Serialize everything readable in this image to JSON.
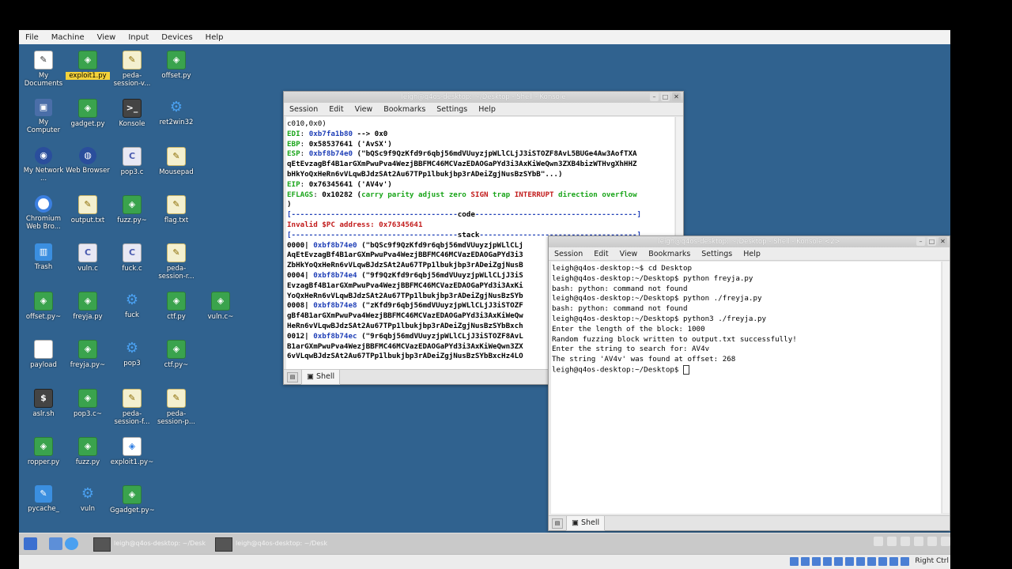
{
  "vm_menu": [
    "File",
    "Machine",
    "View",
    "Input",
    "Devices",
    "Help"
  ],
  "desktop_icons": [
    {
      "label": "My Documents",
      "icon": "my-documents-icon",
      "cls": "g-doc",
      "glyph": "✎",
      "col": 0,
      "row": 0
    },
    {
      "label": "exploit1.py",
      "icon": "python-file-icon",
      "cls": "g-py",
      "glyph": "◈",
      "col": 1,
      "row": 0,
      "selected": true
    },
    {
      "label": "peda-session-v...",
      "icon": "text-file-icon",
      "cls": "g-txt",
      "glyph": "✎",
      "col": 2,
      "row": 0
    },
    {
      "label": "offset.py",
      "icon": "python-file-icon",
      "cls": "g-py",
      "glyph": "◈",
      "col": 3,
      "row": 0
    },
    {
      "label": "My Computer",
      "icon": "my-computer-icon",
      "cls": "g-comp",
      "glyph": "▣",
      "col": 0,
      "row": 1
    },
    {
      "label": "gadget.py",
      "icon": "python-file-icon",
      "cls": "g-py",
      "glyph": "◈",
      "col": 1,
      "row": 1
    },
    {
      "label": "Konsole",
      "icon": "konsole-icon",
      "cls": "g-term",
      "glyph": ">_",
      "col": 2,
      "row": 1
    },
    {
      "label": "ret2win32",
      "icon": "gear-icon",
      "cls": "g-gear",
      "glyph": "⚙",
      "col": 3,
      "row": 1
    },
    {
      "label": "My Network ...",
      "icon": "network-icon",
      "cls": "g-globe",
      "glyph": "◉",
      "col": 0,
      "row": 2
    },
    {
      "label": "Web Browser",
      "icon": "web-browser-icon",
      "cls": "g-globe",
      "glyph": "◍",
      "col": 1,
      "row": 2
    },
    {
      "label": "pop3.c",
      "icon": "c-file-icon",
      "cls": "g-c",
      "glyph": "C",
      "col": 2,
      "row": 2
    },
    {
      "label": "Mousepad",
      "icon": "mousepad-icon",
      "cls": "g-txt",
      "glyph": "✎",
      "col": 3,
      "row": 2
    },
    {
      "label": "Chromium Web Bro...",
      "icon": "chromium-icon",
      "cls": "g-chrome",
      "glyph": "",
      "col": 0,
      "row": 3
    },
    {
      "label": "output.txt",
      "icon": "text-file-icon",
      "cls": "g-txt",
      "glyph": "✎",
      "col": 1,
      "row": 3
    },
    {
      "label": "fuzz.py~",
      "icon": "python-file-icon",
      "cls": "g-py",
      "glyph": "◈",
      "col": 2,
      "row": 3
    },
    {
      "label": "flag.txt",
      "icon": "text-file-icon",
      "cls": "g-txt",
      "glyph": "✎",
      "col": 3,
      "row": 3
    },
    {
      "label": "Trash",
      "icon": "trash-icon",
      "cls": "g-bin",
      "glyph": "▥",
      "col": 0,
      "row": 4
    },
    {
      "label": "vuln.c",
      "icon": "c-file-icon",
      "cls": "g-c",
      "glyph": "C",
      "col": 1,
      "row": 4
    },
    {
      "label": "fuck.c",
      "icon": "c-file-icon",
      "cls": "g-c",
      "glyph": "C",
      "col": 2,
      "row": 4
    },
    {
      "label": "peda-session-r...",
      "icon": "text-file-icon",
      "cls": "g-txt",
      "glyph": "✎",
      "col": 3,
      "row": 4
    },
    {
      "label": "offset.py~",
      "icon": "python-file-icon",
      "cls": "g-py",
      "glyph": "◈",
      "col": 0,
      "row": 5
    },
    {
      "label": "freyja.py",
      "icon": "python-file-icon",
      "cls": "g-py",
      "glyph": "◈",
      "col": 1,
      "row": 5
    },
    {
      "label": "fuck",
      "icon": "gear-icon",
      "cls": "g-gear",
      "glyph": "⚙",
      "col": 2,
      "row": 5
    },
    {
      "label": "ctf.py",
      "icon": "python-file-icon",
      "cls": "g-py",
      "glyph": "◈",
      "col": 3,
      "row": 5
    },
    {
      "label": "vuln.c~",
      "icon": "python-file-icon",
      "cls": "g-py",
      "glyph": "◈",
      "col": 4,
      "row": 5
    },
    {
      "label": "payload",
      "icon": "document-icon",
      "cls": "g-doc",
      "glyph": "",
      "col": 0,
      "row": 6
    },
    {
      "label": "freyja.py~",
      "icon": "python-file-icon",
      "cls": "g-py",
      "glyph": "◈",
      "col": 1,
      "row": 6
    },
    {
      "label": "pop3",
      "icon": "gear-icon",
      "cls": "g-gear",
      "glyph": "⚙",
      "col": 2,
      "row": 6
    },
    {
      "label": "ctf.py~",
      "icon": "python-file-icon",
      "cls": "g-py",
      "glyph": "◈",
      "col": 3,
      "row": 6
    },
    {
      "label": "aslr.sh",
      "icon": "shell-script-icon",
      "cls": "g-term",
      "glyph": "$",
      "col": 0,
      "row": 7
    },
    {
      "label": "pop3.c~",
      "icon": "python-file-icon",
      "cls": "g-py",
      "glyph": "◈",
      "col": 1,
      "row": 7
    },
    {
      "label": "peda-session-f...",
      "icon": "text-file-icon",
      "cls": "g-txt",
      "glyph": "✎",
      "col": 2,
      "row": 7
    },
    {
      "label": "peda-session-p...",
      "icon": "text-file-icon",
      "cls": "g-txt",
      "glyph": "✎",
      "col": 3,
      "row": 7
    },
    {
      "label": "ropper.py",
      "icon": "python-file-icon",
      "cls": "g-py",
      "glyph": "◈",
      "col": 0,
      "row": 8
    },
    {
      "label": "fuzz.py",
      "icon": "python-file-icon",
      "cls": "g-py",
      "glyph": "◈",
      "col": 1,
      "row": 8
    },
    {
      "label": "exploit1.py~",
      "icon": "executable-icon",
      "cls": "g-exe",
      "glyph": "◈",
      "col": 2,
      "row": 8
    },
    {
      "label": "pycache_",
      "icon": "folder-icon",
      "cls": "g-bin",
      "glyph": "✎",
      "col": 0,
      "row": 9
    },
    {
      "label": "vuln",
      "icon": "gear-icon",
      "cls": "g-gear",
      "glyph": "⚙",
      "col": 1,
      "row": 9
    },
    {
      "label": "Ggadget.py~",
      "icon": "python-file-icon",
      "cls": "g-py",
      "glyph": "◈",
      "col": 2,
      "row": 9
    }
  ],
  "konsole1": {
    "title": "leigh@q4os-desktop: ~/Desktop - Shell - Konsole",
    "menu": [
      "Session",
      "Edit",
      "View",
      "Bookmarks",
      "Settings",
      "Help"
    ],
    "tab": "Shell",
    "lines": [
      [
        [
          "",
          "c010,0x0)"
        ]
      ],
      [
        [
          "g",
          "EDI"
        ],
        [
          "",
          ": "
        ],
        [
          "b",
          "0xb7fa1b80"
        ],
        [
          "k",
          " --> 0x0"
        ]
      ],
      [
        [
          "g",
          "EBP"
        ],
        [
          "",
          ": "
        ],
        [
          "k",
          "0x58537641 ('AvSX')"
        ]
      ],
      [
        [
          "g",
          "ESP"
        ],
        [
          "",
          ": "
        ],
        [
          "b",
          "0xbf8b74e0"
        ],
        [
          "k",
          " (\"bQSc9f9QzKfd9r6qbj56mdVUuyzjpWLlCLjJ3iSTOZF8AvL5BUGe4Aw3AofTXA"
        ]
      ],
      [
        [
          "k",
          "qEtEvzagBf4B1arGXmPwuPva4WezjBBFMC46MCVazEDAOGaPYd3i3AxKiWeQwn3ZXB4bizWTHvgXhHHZ"
        ]
      ],
      [
        [
          "k",
          "bHkYoQxHeRn6vVLqwBJdzSAt2Au67TPp1lbukjbp3rADeiZgjNusBzSYbB\"...)"
        ]
      ],
      [
        [
          "g",
          "EIP"
        ],
        [
          "",
          ": "
        ],
        [
          "k",
          "0x76345641 ('AV4v')"
        ]
      ],
      [
        [
          "g",
          "EFLAGS"
        ],
        [
          "",
          ": "
        ],
        [
          "k",
          "0x10282 ("
        ],
        [
          "g",
          "carry parity adjust zero "
        ],
        [
          "r",
          "SIGN"
        ],
        [
          "g",
          " trap "
        ],
        [
          "r",
          "INTERRUPT"
        ],
        [
          "g",
          " direction overflow"
        ]
      ],
      [
        [
          "k",
          ")"
        ]
      ],
      [
        [
          "b",
          "[--------------------------------------"
        ],
        [
          "k",
          "code"
        ],
        [
          "b",
          "-------------------------------------]"
        ]
      ],
      [
        [
          "r",
          "Invalid $PC address: 0x76345641"
        ]
      ],
      [
        [
          "b",
          "[--------------------------------------"
        ],
        [
          "k",
          "stack"
        ],
        [
          "b",
          "------------------------------------]"
        ]
      ],
      [
        [
          "k",
          "0000| "
        ],
        [
          "b",
          "0xbf8b74e0"
        ],
        [
          "k",
          " (\"bQSc9f9QzKfd9r6qbj56mdVUuyzjpWLlCLj"
        ]
      ],
      [
        [
          "k",
          "AqEtEvzagBf4B1arGXmPwuPva4WezjBBFMC46MCVazEDAOGaPYd3i3"
        ]
      ],
      [
        [
          "k",
          "ZbHkYoQxHeRn6vVLqwBJdzSAt2Au67TPp1lbukjbp3rADeiZgjNusB"
        ]
      ],
      [
        [
          "k",
          "0004| "
        ],
        [
          "b",
          "0xbf8b74e4"
        ],
        [
          "k",
          " (\"9f9QzKfd9r6qbj56mdVUuyzjpWLlCLjJ3iS"
        ]
      ],
      [
        [
          "k",
          "EvzagBf4B1arGXmPwuPva4WezjBBFMC46MCVazEDAOGaPYd3i3AxKi"
        ]
      ],
      [
        [
          "k",
          "YoQxHeRn6vVLqwBJdzSAt2Au67TPp1lbukjbp3rADeiZgjNusBzSYb"
        ]
      ],
      [
        [
          "k",
          "0008| "
        ],
        [
          "b",
          "0xbf8b74e8"
        ],
        [
          "k",
          " (\"zKfd9r6qbj56mdVUuyzjpWLlCLjJ3iSTOZF"
        ]
      ],
      [
        [
          "k",
          "gBf4B1arGXmPwuPva4WezjBBFMC46MCVazEDAOGaPYd3i3AxKiWeQw"
        ]
      ],
      [
        [
          "k",
          "HeRn6vVLqwBJdzSAt2Au67TPp1lbukjbp3rADeiZgjNusBzSYbBxch"
        ]
      ],
      [
        [
          "k",
          "0012| "
        ],
        [
          "b",
          "0xbf8b74ec"
        ],
        [
          "k",
          " (\"9r6qbj56mdVUuyzjpWLlCLjJ3iSTOZF8AvL"
        ]
      ],
      [
        [
          "k",
          "B1arGXmPwuPva4WezjBBFMC46MCVazEDAOGaPYd3i3AxKiWeQwn3ZX"
        ]
      ],
      [
        [
          "k",
          "6vVLqwBJdzSAt2Au67TPp1lbukjbp3rADeiZgjNusBzSYbBxcHz4LO"
        ]
      ]
    ]
  },
  "konsole2": {
    "title": "leigh@q4os-desktop: ~/Desktop - Shell - Konsole <2>",
    "menu": [
      "Session",
      "Edit",
      "View",
      "Bookmarks",
      "Settings",
      "Help"
    ],
    "tab": "Shell",
    "lines": [
      "leigh@q4os-desktop:~$ cd Desktop",
      "leigh@q4os-desktop:~/Desktop$ python freyja.py",
      "bash: python: command not found",
      "leigh@q4os-desktop:~/Desktop$ python ./freyja.py",
      "bash: python: command not found",
      "leigh@q4os-desktop:~/Desktop$ python3 ./freyja.py",
      "Enter the length of the block: 1000",
      "Random fuzzing block written to output.txt successfully!",
      "Enter the string to search for: AV4v",
      "The string 'AV4v' was found at offset: 268",
      "leigh@q4os-desktop:~/Desktop$ "
    ]
  },
  "taskbar": {
    "tasks": [
      "leigh@q4os-desktop: ~/Desk",
      "leigh@q4os-desktop: ~/Desk"
    ]
  },
  "statusbar": {
    "host_key": "Right Ctrl"
  },
  "colors": {
    "desktop": "#30628f",
    "green": "#1aa51a",
    "blue": "#1f3fb7",
    "red": "#c21b1b"
  }
}
